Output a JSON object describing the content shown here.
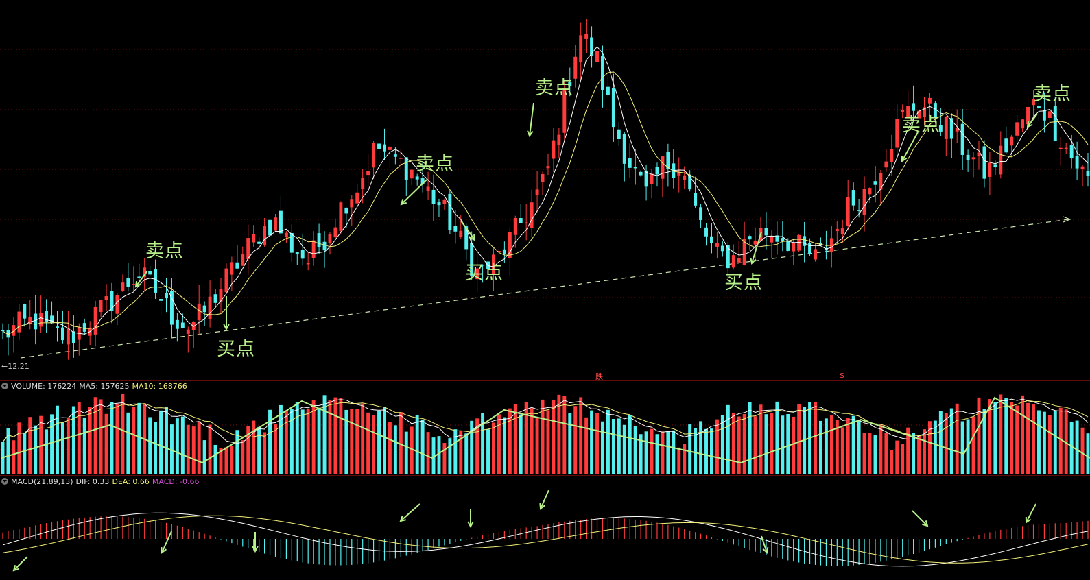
{
  "colors": {
    "background": "#000000",
    "up": "#ff3b3b",
    "down": "#54f0f0",
    "ma5": "#ffffff",
    "ma10": "#f2f07a",
    "annotation": "#b8f08a",
    "grid": "#7a1010",
    "trendline": "#cfe8b0",
    "macd_label": "#d050d0"
  },
  "price_panel": {
    "low_label": "12.21",
    "marker_left": "跌",
    "marker_right": "$",
    "annotations": [
      {
        "text": "卖点"
      },
      {
        "text": "买点"
      },
      {
        "text": "卖点"
      },
      {
        "text": "买点"
      },
      {
        "text": "卖点"
      },
      {
        "text": "买点"
      },
      {
        "text": "卖点"
      },
      {
        "text": "卖点"
      }
    ]
  },
  "volume_panel": {
    "label": "VOLUME: 176224",
    "ma5_label": "MA5: 157625",
    "ma10_label": "MA10: 168766"
  },
  "macd_panel": {
    "label": "MACD(21,89,13)",
    "dif_label": "DIF: 0.33",
    "dea_label": "DEA: 0.66",
    "macd_label": "MACD: -0.66"
  },
  "chart_data": [
    {
      "type": "candlestick",
      "title": "",
      "series": [
        {
          "name": "price",
          "close_path": [
            13.0,
            13.6,
            13.9,
            13.1,
            12.9,
            13.8,
            14.6,
            15.6,
            16.6,
            15.6,
            14.1,
            13.5,
            14.5,
            16.0,
            17.4,
            18.8,
            19.6,
            18.2,
            17.3,
            18.7,
            20.5,
            21.7,
            23.9,
            23.2,
            22.6,
            21.4,
            20.2,
            18.4,
            16.6,
            17.2,
            18.6,
            20.2,
            22.0,
            26.0,
            30.5,
            29.0,
            25.2,
            22.9,
            21.0,
            22.9,
            22.8,
            19.7,
            17.7,
            17.4,
            18.6,
            19.0,
            18.7,
            18.0,
            17.4,
            18.8,
            20.6,
            21.4,
            23.4,
            25.6,
            26.4,
            25.8,
            24.5,
            23.4,
            22.3,
            23.6,
            25.2,
            26.6,
            25.1,
            23.3,
            22.0
          ]
        }
      ],
      "indicators": [
        "MA5",
        "MA10"
      ],
      "annotations": [
        "卖点",
        "买点"
      ]
    },
    {
      "type": "bar",
      "title": "VOLUME",
      "series": [
        {
          "name": "VOLUME",
          "value": 176224
        },
        {
          "name": "MA5",
          "value": 157625
        },
        {
          "name": "MA10",
          "value": 168766
        }
      ]
    },
    {
      "type": "bar",
      "title": "MACD(21,89,13)",
      "series": [
        {
          "name": "DIF",
          "value": 0.33
        },
        {
          "name": "DEA",
          "value": 0.66
        },
        {
          "name": "MACD",
          "value": -0.66
        }
      ]
    }
  ]
}
